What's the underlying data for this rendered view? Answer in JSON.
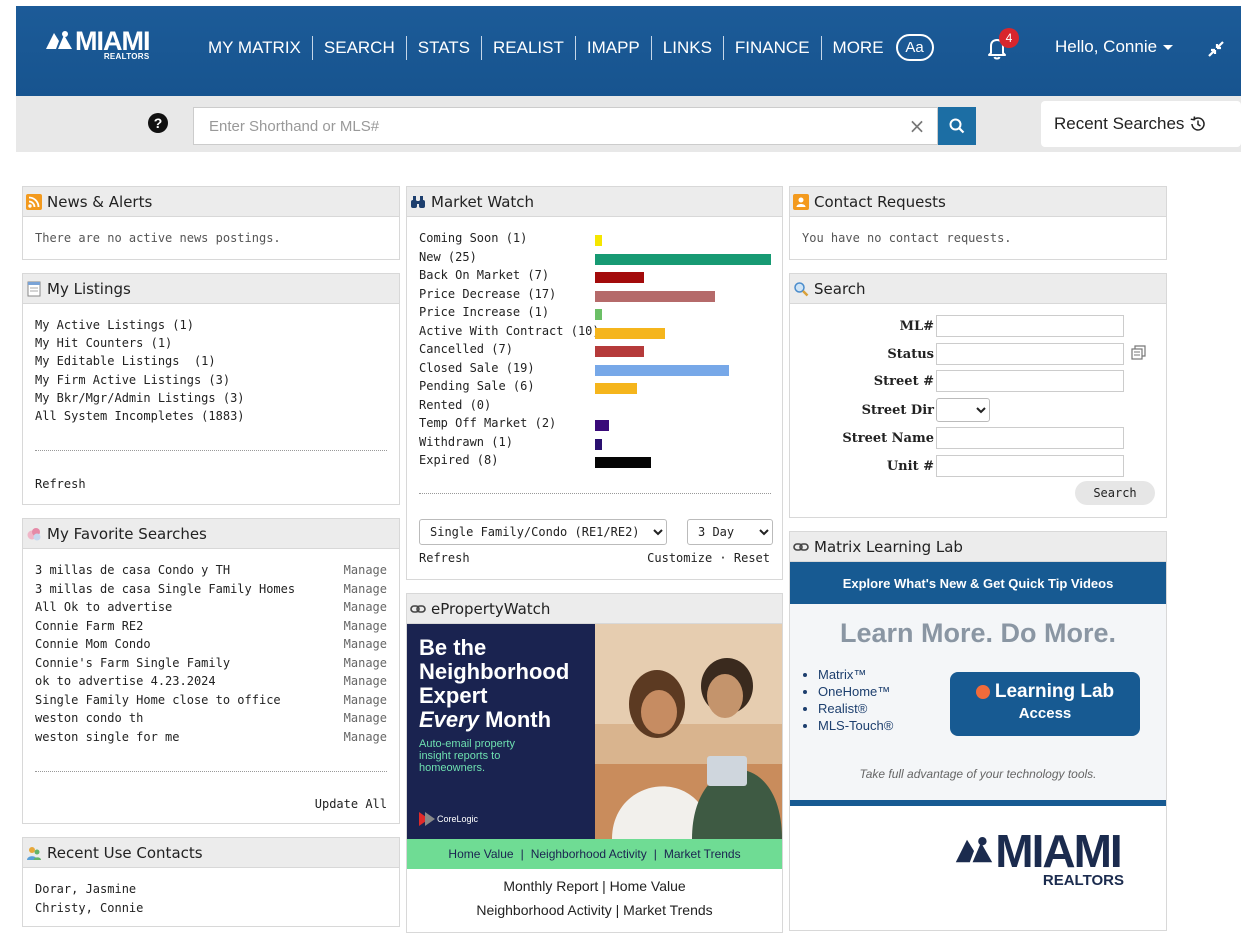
{
  "header": {
    "logo_text": "MIAMI",
    "logo_sub": "REALTORS",
    "nav": [
      "MY MATRIX",
      "SEARCH",
      "STATS",
      "REALIST",
      "IMAPP",
      "LINKS",
      "FINANCE",
      "MORE"
    ],
    "font_button": "Aa",
    "notification_count": "4",
    "greeting": "Hello, Connie"
  },
  "search": {
    "placeholder": "Enter Shorthand or MLS#",
    "recent_label": "Recent Searches"
  },
  "news": {
    "title": "News & Alerts",
    "empty": "There are no active news postings."
  },
  "my_listings": {
    "title": "My Listings",
    "items": [
      "My Active Listings (1)",
      "My Hit Counters (1)",
      "My Editable Listings  (1)",
      "My Firm Active Listings (3)",
      "My Bkr/Mgr/Admin Listings (3)",
      "All System Incompletes (1883)"
    ],
    "refresh": "Refresh"
  },
  "favorite_searches": {
    "title": "My Favorite Searches",
    "manage_label": "Manage",
    "items": [
      "3 millas de casa Condo y TH",
      "3 millas de casa Single Family Homes",
      "All Ok to advertise",
      "Connie Farm RE2",
      "Connie Mom Condo",
      "Connie's Farm Single Family",
      "ok to advertise 4.23.2024",
      "Single Family Home close to office",
      "weston condo th",
      "weston single for me"
    ],
    "update_all": "Update All"
  },
  "recent_contacts": {
    "title": "Recent Use Contacts",
    "items": [
      "Dorar, Jasmine",
      "Christy, Connie"
    ]
  },
  "market_watch": {
    "title": "Market Watch",
    "rows": [
      {
        "label": "Coming Soon (1)",
        "count": 1,
        "color": "#f5e600"
      },
      {
        "label": "New (25)",
        "count": 25,
        "color": "#179a73"
      },
      {
        "label": "Back On Market (7)",
        "count": 7,
        "color": "#a30b0b"
      },
      {
        "label": "Price Decrease (17)",
        "count": 17,
        "color": "#b56a6a"
      },
      {
        "label": "Price Increase (1)",
        "count": 1,
        "color": "#6bbf66"
      },
      {
        "label": "Active With Contract (10)",
        "count": 10,
        "color": "#f5b51c"
      },
      {
        "label": "Cancelled (7)",
        "count": 7,
        "color": "#b53a3a"
      },
      {
        "label": "Closed Sale (19)",
        "count": 19,
        "color": "#77a8e8"
      },
      {
        "label": "Pending Sale (6)",
        "count": 6,
        "color": "#f5b51c"
      },
      {
        "label": "Rented (0)",
        "count": 0,
        "color": "#999999"
      },
      {
        "label": "Temp Off Market (2)",
        "count": 2,
        "color": "#3a0a7a"
      },
      {
        "label": "Withdrawn (1)",
        "count": 1,
        "color": "#2a1070"
      },
      {
        "label": "Expired (8)",
        "count": 8,
        "color": "#050505"
      }
    ],
    "property_type": "Single Family/Condo (RE1/RE2)",
    "period": "3 Day",
    "refresh": "Refresh",
    "customize": "Customize",
    "separator": "·",
    "reset": "Reset"
  },
  "epropertywatch": {
    "title": "ePropertyWatch",
    "ad_line1": "Be the",
    "ad_line2": "Neighborhood",
    "ad_line3": "Expert",
    "ad_line4_em": "Every",
    "ad_line4_rest": " Month",
    "ad_sub": "Auto-email property insight reports to homeowners.",
    "ad_brand": "CoreLogic",
    "ad_footer": [
      "Home Value",
      "Neighborhood Activity",
      "Market Trends"
    ],
    "links_line1": [
      "Monthly Report",
      "Home Value"
    ],
    "links_line2": [
      "Neighborhood Activity",
      "Market Trends"
    ]
  },
  "contact_requests": {
    "title": "Contact Requests",
    "empty": "You have no contact requests."
  },
  "search_panel": {
    "title": "Search",
    "fields": [
      "ML#",
      "Status",
      "Street #",
      "Street Dir",
      "Street Name",
      "Unit #"
    ],
    "button": "Search"
  },
  "learning_lab": {
    "title": "Matrix Learning Lab",
    "banner": "Explore What's New & Get Quick Tip Videos",
    "headline": "Learn More. Do More.",
    "bullets": [
      "Matrix™",
      "OneHome™",
      "Realist®",
      "MLS-Touch®"
    ],
    "button_line1": "Learning Lab",
    "button_line2": "Access",
    "tagline": "Take full advantage of your technology tools."
  },
  "footer_logo": {
    "text": "MIAMI",
    "sub": "REALTORS"
  }
}
